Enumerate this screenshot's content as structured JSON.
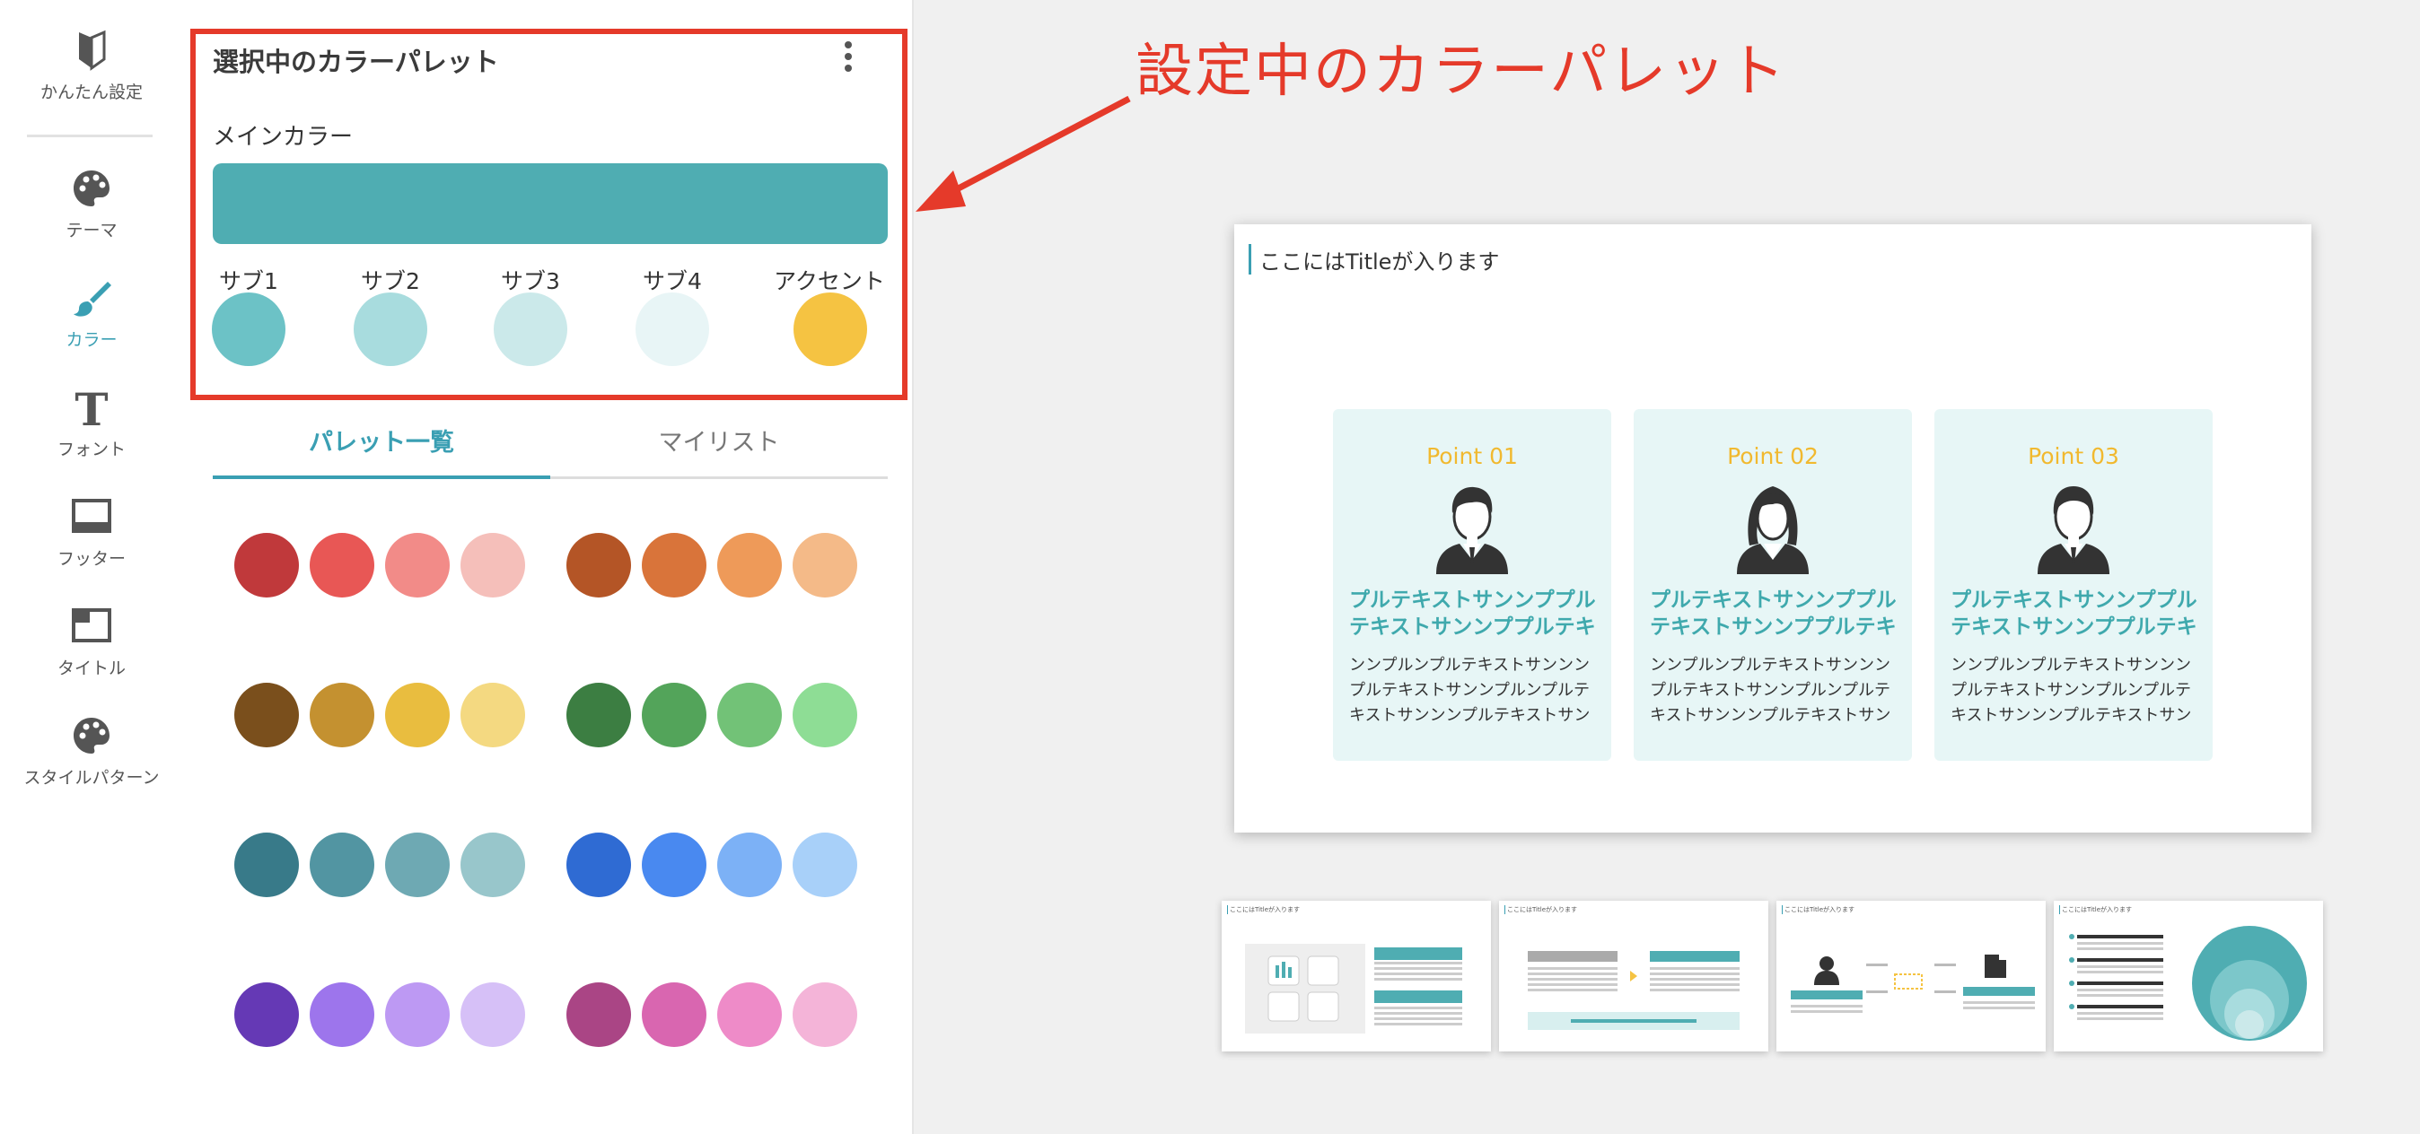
{
  "nav": {
    "items": [
      {
        "label": "かんたん設定",
        "icon": "beginner-mark-icon"
      },
      {
        "label": "テーマ",
        "icon": "palette-icon"
      },
      {
        "label": "カラー",
        "icon": "paintbrush-icon",
        "active": true
      },
      {
        "label": "フォント",
        "icon": "font-t-icon"
      },
      {
        "label": "フッター",
        "icon": "footer-layout-icon"
      },
      {
        "label": "タイトル",
        "icon": "title-layout-icon"
      },
      {
        "label": "スタイルパターン",
        "icon": "palette-icon"
      }
    ]
  },
  "panel": {
    "title": "選択中のカラーパレット",
    "main_label": "メインカラー",
    "main_color": "#4fadb2",
    "subs": [
      {
        "label": "サブ1",
        "color": "#6cc2c6"
      },
      {
        "label": "サブ2",
        "color": "#a8dcde"
      },
      {
        "label": "サブ3",
        "color": "#cbe9ea"
      },
      {
        "label": "サブ4",
        "color": "#e8f5f6"
      },
      {
        "label": "アクセント",
        "color": "#f5c342"
      }
    ],
    "tabs": [
      "パレット一覧",
      "マイリスト"
    ],
    "palettes": [
      [
        "#c0393b",
        "#e85755",
        "#f28b88",
        "#f5bfba"
      ],
      [
        "#b45526",
        "#d9743a",
        "#ee9a59",
        "#f4ba88"
      ],
      [
        "#7a4f1c",
        "#c49130",
        "#e9bd3f",
        "#f4d981"
      ],
      [
        "#3c7e42",
        "#53a45a",
        "#72c277",
        "#8edd95"
      ],
      [
        "#387a89",
        "#5295a2",
        "#6ea9b3",
        "#98c6cb"
      ],
      [
        "#2f6bd3",
        "#4989f0",
        "#7cb1f6",
        "#a8d0f9"
      ],
      [
        "#6539b5",
        "#9d75ec",
        "#bd99f3",
        "#d6c0f7"
      ],
      [
        "#aa4585",
        "#d966b0",
        "#ee8bc8",
        "#f4b4d8"
      ]
    ]
  },
  "annotation": {
    "text": "設定中のカラーパレット",
    "color": "#e53a2a"
  },
  "slide": {
    "title": "ここにはTitleが入ります",
    "cards": [
      {
        "point": "Point 01",
        "figure": "male",
        "heading": [
          "プルテキストサンンププル",
          "テキストサンンププルテキ"
        ],
        "body": [
          "ンンプルンプルテキストサンンン",
          "プルテキストサンンプルンプルテ",
          "キストサンンンプルテキストサン"
        ]
      },
      {
        "point": "Point 02",
        "figure": "female",
        "heading": [
          "プルテキストサンンププル",
          "テキストサンンププルテキ"
        ],
        "body": [
          "ンンプルンプルテキストサンンン",
          "プルテキストサンンプルンプルテ",
          "キストサンンンプルテキストサン"
        ]
      },
      {
        "point": "Point 03",
        "figure": "male",
        "heading": [
          "プルテキストサンンププル",
          "テキストサンンププルテキ"
        ],
        "body": [
          "ンンプルンプルテキストサンンン",
          "プルテキストサンンプルンプルテ",
          "キストサンンンプルテキストサン"
        ]
      }
    ]
  },
  "thumbnails": [
    {
      "title": "ここにはTitleが入ります"
    },
    {
      "title": "ここにはTitleが入ります"
    },
    {
      "title": "ここにはTitleが入ります"
    },
    {
      "title": "ここにはTitleが入ります"
    }
  ]
}
